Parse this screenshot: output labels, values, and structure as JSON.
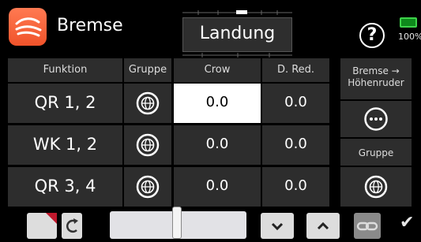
{
  "header": {
    "title": "Bremse",
    "phase": "Landung",
    "help_label": "?",
    "battery_percent": "100%"
  },
  "table": {
    "columns": [
      "Funktion",
      "Gruppe",
      "Crow",
      "D. Red."
    ],
    "rows": [
      {
        "label": "QR 1, 2",
        "crow": "0.0",
        "dred": "0.0"
      },
      {
        "label": "WK 1, 2",
        "crow": "0.0",
        "dred": "0.0"
      },
      {
        "label": "QR 3, 4",
        "crow": "0.0",
        "dred": "0.0"
      }
    ]
  },
  "side": {
    "bremse_label": "Bremse →",
    "hoehenruder_label": "Höhenruder",
    "gruppe_label": "Gruppe"
  },
  "colors": {
    "accent": "#f0532a",
    "battery": "#2fc23c",
    "selected_cell": "#ffffff"
  },
  "icons": {
    "app": "brake-icon",
    "group": "globe-icon",
    "more": "more-icon",
    "reset": "reset-icon",
    "down": "chevron-down-icon",
    "up": "chevron-up-icon",
    "link": "link-icon",
    "confirm": "check-icon"
  }
}
